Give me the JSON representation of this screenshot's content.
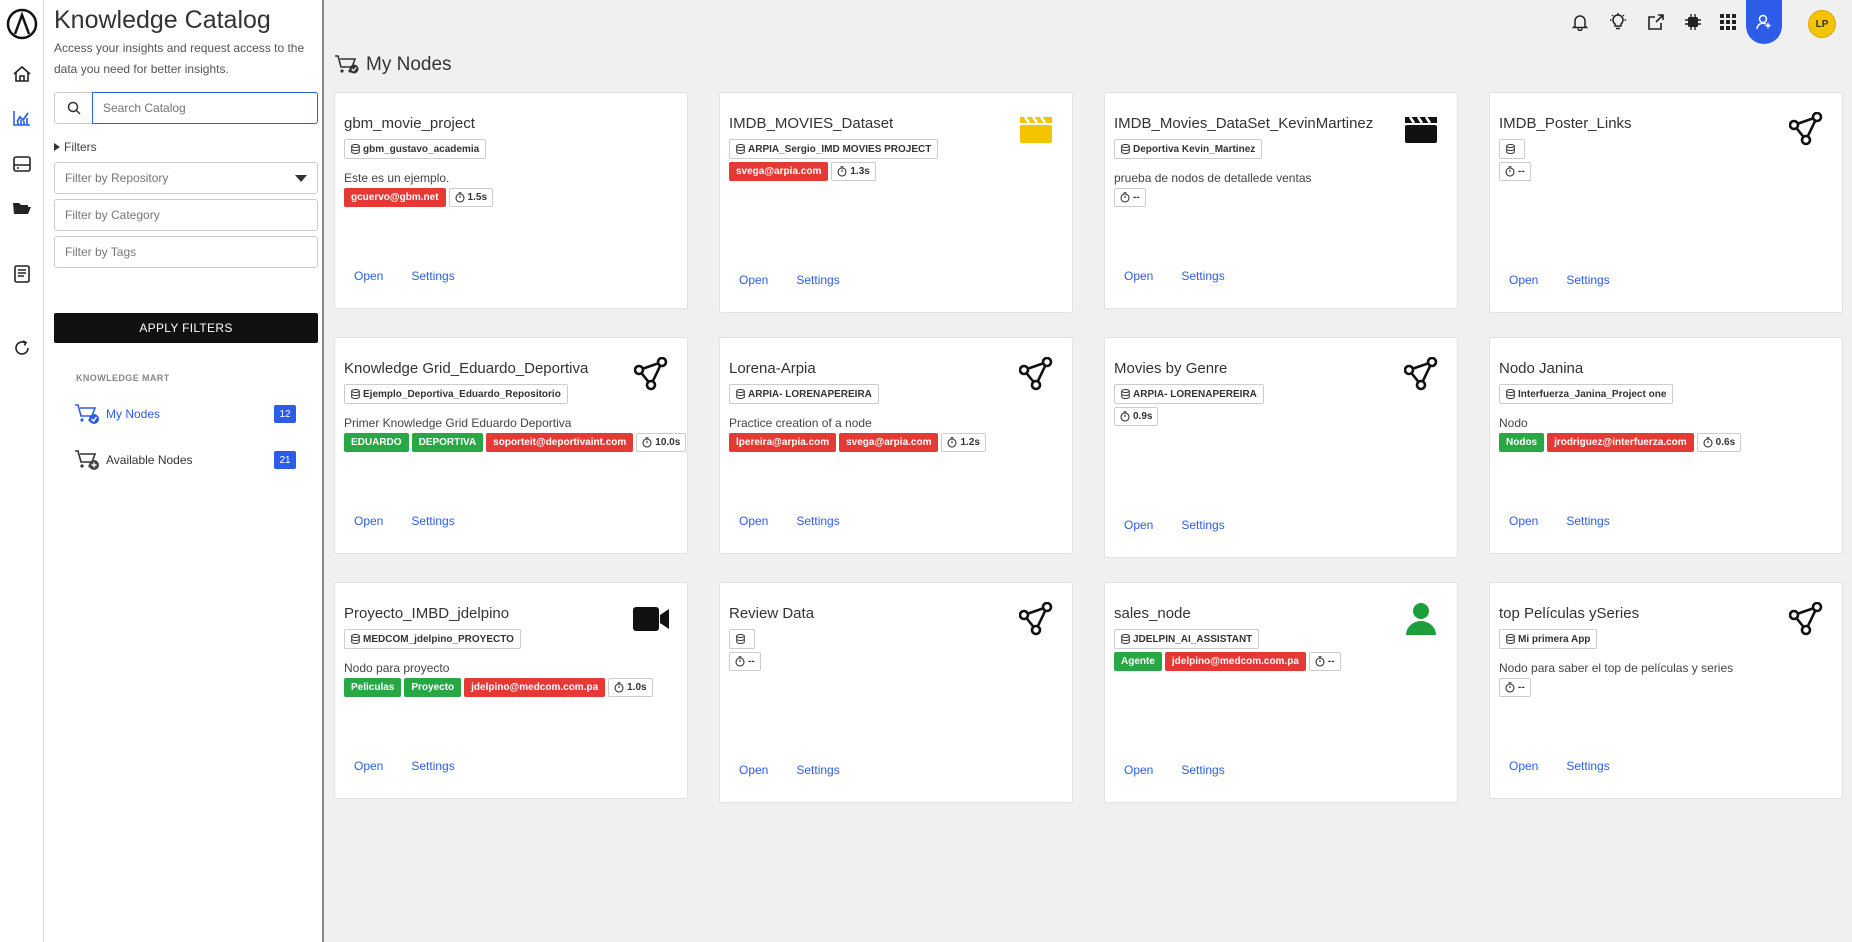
{
  "sidebar": {
    "title": "Knowledge Catalog",
    "subtitle": "Access your insights and request access to the data you need for better insights.",
    "search_placeholder": "Search Catalog",
    "filters_label": "Filters",
    "repo_placeholder": "Filter by Repository",
    "category_placeholder": "Filter by Category",
    "tags_placeholder": "Filter by Tags",
    "apply_label": "APPLY FILTERS",
    "section_label": "KNOWLEDGE MART",
    "nav": [
      {
        "label": "My Nodes",
        "count": "12"
      },
      {
        "label": "Available Nodes",
        "count": "21"
      }
    ]
  },
  "header": {
    "avatar_initials": "LP"
  },
  "main": {
    "title": "My Nodes"
  },
  "cards": [
    {
      "title": "gbm_movie_project",
      "icon": "none",
      "repo": "gbm_gustavo_academia",
      "desc": "Este es un ejemplo.",
      "tags": [
        {
          "text": "gcuervo@gbm.net",
          "color": "red"
        }
      ],
      "time": "1.5s",
      "open": "Open",
      "settings": "Settings"
    },
    {
      "title": "IMDB_MOVIES_Dataset",
      "icon": "clapper-yellow",
      "repo": "ARPIA_Sergio_IMD MOVIES PROJECT",
      "desc": "",
      "tags": [
        {
          "text": "svega@arpia.com",
          "color": "red"
        }
      ],
      "time": "1.3s",
      "open": "Open",
      "settings": "Settings"
    },
    {
      "title": "IMDB_Movies_DataSet_KevinMartinez",
      "icon": "clapper-black",
      "repo": "Deportiva Kevin_Martinez",
      "desc": "prueba de nodos de detallede ventas",
      "tags": [],
      "time": "--",
      "open": "Open",
      "settings": "Settings"
    },
    {
      "title": "IMDB_Poster_Links",
      "icon": "graph",
      "repo": "",
      "desc": "",
      "tags": [],
      "time": "--",
      "open": "Open",
      "settings": "Settings"
    },
    {
      "title": "Knowledge Grid_Eduardo_Deportiva",
      "icon": "graph",
      "repo": "Ejemplo_Deportiva_Eduardo_Repositorio",
      "desc": "Primer Knowledge Grid Eduardo Deportiva",
      "tags": [
        {
          "text": "EDUARDO",
          "color": "green"
        },
        {
          "text": "DEPORTIVA",
          "color": "green"
        },
        {
          "text": "soporteit@deportivaint.com",
          "color": "red"
        }
      ],
      "time": "10.0s",
      "open": "Open",
      "settings": "Settings"
    },
    {
      "title": "Lorena-Arpia",
      "icon": "graph",
      "repo": "ARPIA- LORENAPEREIRA",
      "desc": "Practice creation of a node",
      "tags": [
        {
          "text": "lpereira@arpia.com",
          "color": "red"
        },
        {
          "text": "svega@arpia.com",
          "color": "red"
        }
      ],
      "time": "1.2s",
      "open": "Open",
      "settings": "Settings"
    },
    {
      "title": "Movies by Genre",
      "icon": "graph",
      "repo": "ARPIA- LORENAPEREIRA",
      "desc": "",
      "tags": [],
      "time": "0.9s",
      "open": "Open",
      "settings": "Settings"
    },
    {
      "title": "Nodo Janina",
      "icon": "none",
      "repo": "Interfuerza_Janina_Project one",
      "desc": "Nodo",
      "tags": [
        {
          "text": "Nodos",
          "color": "green"
        },
        {
          "text": "jrodriguez@interfuerza.com",
          "color": "red"
        }
      ],
      "time": "0.6s",
      "open": "Open",
      "settings": "Settings"
    },
    {
      "title": "Proyecto_IMBD_jdelpino",
      "icon": "video",
      "repo": "MEDCOM_jdelpino_PROYECTO",
      "desc": "Nodo para proyecto",
      "tags": [
        {
          "text": "Peliculas",
          "color": "green"
        },
        {
          "text": "Proyecto",
          "color": "green"
        },
        {
          "text": "jdelpino@medcom.com.pa",
          "color": "red"
        }
      ],
      "time": "1.0s",
      "open": "Open",
      "settings": "Settings"
    },
    {
      "title": "Review Data",
      "icon": "graph",
      "repo": "",
      "desc": "",
      "tags": [],
      "time": "--",
      "open": "Open",
      "settings": "Settings"
    },
    {
      "title": "sales_node",
      "icon": "person-green",
      "repo": "JDELPIN_AI_ASSISTANT",
      "desc": "",
      "tags": [
        {
          "text": "Agente",
          "color": "green"
        },
        {
          "text": "jdelpino@medcom.com.pa",
          "color": "red"
        }
      ],
      "time": "--",
      "open": "Open",
      "settings": "Settings"
    },
    {
      "title": "top Películas ySeries",
      "icon": "graph",
      "repo": "Mi primera App",
      "desc": "Nodo para saber el top de películas y series",
      "tags": [],
      "time": "--",
      "open": "Open",
      "settings": "Settings"
    }
  ],
  "colors": {
    "accent": "#2d5de8",
    "tag_green": "#28a745",
    "tag_red": "#e53935",
    "avatar": "#f5c400"
  }
}
